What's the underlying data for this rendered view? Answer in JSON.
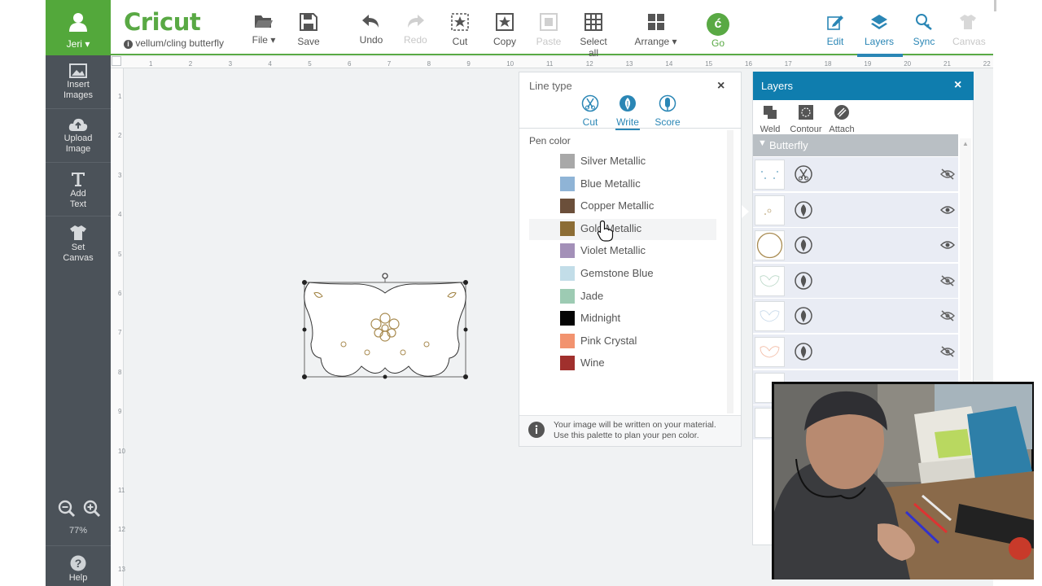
{
  "user": {
    "name": "Jeri"
  },
  "project": {
    "name": "vellum/cling butterfly"
  },
  "toolbar": {
    "file": "File",
    "save": "Save",
    "undo": "Undo",
    "redo": "Redo",
    "cut": "Cut",
    "copy": "Copy",
    "paste": "Paste",
    "select_all": "Select all",
    "arrange": "Arrange",
    "go": "Go",
    "edit": "Edit",
    "layers": "Layers",
    "sync": "Sync",
    "canvas": "Canvas"
  },
  "sidebar": {
    "items": [
      {
        "label1": "Insert",
        "label2": "Images"
      },
      {
        "label1": "Upload",
        "label2": "Image"
      },
      {
        "label1": "Add",
        "label2": "Text"
      },
      {
        "label1": "Set",
        "label2": "Canvas"
      }
    ],
    "zoom": "77%",
    "help": "Help"
  },
  "ruler": {
    "top": [
      "1",
      "2",
      "3",
      "4",
      "5",
      "6",
      "7",
      "8",
      "9",
      "10",
      "11",
      "12",
      "13",
      "14",
      "15",
      "16",
      "17",
      "18",
      "19",
      "20",
      "21",
      "22"
    ],
    "left": [
      "1",
      "2",
      "3",
      "4",
      "5",
      "6",
      "7",
      "8",
      "9",
      "10",
      "11",
      "12",
      "13"
    ]
  },
  "linetype": {
    "title": "Line type",
    "cut": "Cut",
    "write": "Write",
    "score": "Score",
    "pen_color_label": "Pen color",
    "colors": [
      {
        "name": "Silver Metallic",
        "hex": "#a8a8a8"
      },
      {
        "name": "Blue Metallic",
        "hex": "#8fb4d6"
      },
      {
        "name": "Copper Metallic",
        "hex": "#6b4f3a"
      },
      {
        "name": "Gold Metallic",
        "hex": "#8c6d35"
      },
      {
        "name": "Violet Metallic",
        "hex": "#a390b8"
      },
      {
        "name": "Gemstone Blue",
        "hex": "#c2dde8"
      },
      {
        "name": "Jade",
        "hex": "#9dcbb3"
      },
      {
        "name": "Midnight",
        "hex": "#050505"
      },
      {
        "name": "Pink Crystal",
        "hex": "#f2936f"
      },
      {
        "name": "Wine",
        "hex": "#a0302d"
      }
    ],
    "info1": "Your image will be written on your material.",
    "info2": "Use this palette to plan your pen color."
  },
  "layers": {
    "title": "Layers",
    "weld": "Weld",
    "contour": "Contour",
    "attach": "Attach",
    "group": "Butterfly"
  },
  "colors": {
    "accent": "#59a944",
    "panel_header": "#0f7dae",
    "sidebar": "#4b5259"
  }
}
